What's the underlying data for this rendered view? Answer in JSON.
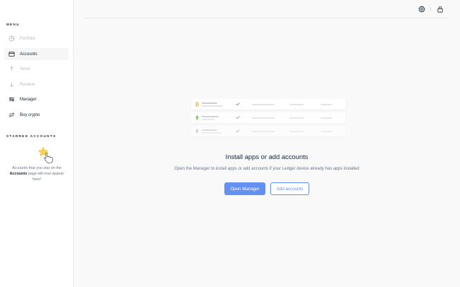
{
  "sidebar": {
    "menu_title": "MENU",
    "items": [
      {
        "label": "Portfolio",
        "icon": "portfolio-icon",
        "state": "disabled"
      },
      {
        "label": "Accounts",
        "icon": "wallet-icon",
        "state": "active"
      },
      {
        "label": "Send",
        "icon": "send-icon",
        "state": "disabled"
      },
      {
        "label": "Receive",
        "icon": "receive-icon",
        "state": "disabled"
      },
      {
        "label": "Manager",
        "icon": "manager-icon",
        "state": "normal"
      },
      {
        "label": "Buy crypto",
        "icon": "exchange-icon",
        "state": "normal"
      }
    ],
    "starred_title": "STARRED ACCOUNTS",
    "starred_empty_pre": "Accounts that you star on the ",
    "starred_empty_bold": "Accounts",
    "starred_empty_post": " page will now appear here!"
  },
  "topbar": {
    "icons": [
      "settings-icon",
      "lock-icon"
    ]
  },
  "empty_state": {
    "title": "Install apps or add accounts",
    "description": "Open the Manager to install apps or add accounts if your Ledger device already has apps installed",
    "primary_button": "Open Manager",
    "secondary_button": "Add accounts"
  },
  "colors": {
    "accent": "#6490f1",
    "text": "#142533",
    "muted": "#6a7784",
    "disabled": "#b5bcc4",
    "background": "#f9f9f9",
    "bitcoin": "#f7b731",
    "ethereum": "#66be54"
  }
}
